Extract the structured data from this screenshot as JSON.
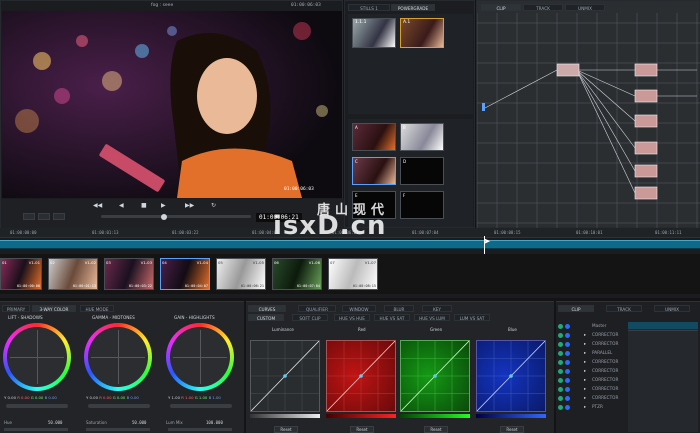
{
  "viewer": {
    "title": "fog : seee",
    "timecode_top": "01:00:06:03",
    "overlay_timecode": "01:00:06:03",
    "bottom_timecode": "01:00:06:21"
  },
  "gallery": {
    "tabs": [
      "STILLS 1",
      "POWERGRADE"
    ],
    "top_stills": [
      {
        "label": "1.1.1"
      },
      {
        "label": "A.1"
      }
    ],
    "memory_labels": [
      "A",
      "B",
      "C",
      "D",
      "E",
      "F"
    ]
  },
  "node_editor": {
    "tabs": [
      "CLIP",
      "TRACK",
      "UNMIX"
    ]
  },
  "timeline": {
    "ruler": [
      "01:00:00:00",
      "01:00:01:13",
      "01:00:03:22",
      "01:00:04:07",
      "01:00:06:21",
      "01:00:07:04",
      "01:00:08:15",
      "01:00:10:01",
      "01:00:11:11"
    ],
    "clips": [
      {
        "id": "01",
        "track": "V1-01",
        "tc": "01:00:00:00"
      },
      {
        "id": "02",
        "track": "V1-02",
        "tc": "01:00:01:13"
      },
      {
        "id": "03",
        "track": "V1-03",
        "tc": "01:00:03:22"
      },
      {
        "id": "04",
        "track": "V1-04",
        "tc": "01:00:04:07"
      },
      {
        "id": "05",
        "track": "V1-05",
        "tc": "01:00:06:21"
      },
      {
        "id": "06",
        "track": "V1-06",
        "tc": "01:00:07:04"
      },
      {
        "id": "07",
        "track": "V1-07",
        "tc": "01:00:08:15"
      }
    ]
  },
  "watermark": {
    "text": "isxD.cn",
    "cn": "唐山现代"
  },
  "color_panel": {
    "tabs": [
      "PRIMARY",
      "3-WAY COLOR",
      "HUE MODE"
    ],
    "wheels": [
      {
        "label": "LIFT - SHADOWS",
        "values": [
          "Y 0.00",
          "R 0.00",
          "G 0.00",
          "B 0.00"
        ]
      },
      {
        "label": "GAMMA - MIDTONES",
        "values": [
          "Y 0.00",
          "R 0.00",
          "G 0.00",
          "B 0.00"
        ]
      },
      {
        "label": "GAIN - HIGHLIGHTS",
        "values": [
          "Y 1.00",
          "R 1.00",
          "G 1.00",
          "B 1.00"
        ]
      }
    ],
    "params": [
      {
        "label": "Hue",
        "value": "50.000"
      },
      {
        "label": "Saturation",
        "value": "50.000"
      },
      {
        "label": "Lum Mix",
        "value": "100.000"
      }
    ]
  },
  "curves": {
    "tabs": [
      "CURVES",
      "QUALIFIER",
      "WINDOW",
      "BLUR",
      "KEY"
    ],
    "subtabs": [
      "CUSTOM",
      "SOFT CLIP",
      "HUE VS HUE",
      "HUE VS SAT",
      "HUE VS LUM",
      "LUM VS SAT"
    ],
    "channels": [
      {
        "label": "Luminance",
        "color": "#d8d8d8",
        "bg": "#2a2d30"
      },
      {
        "label": "Red",
        "color": "#ff3a3a",
        "bg": "#8a0c0c"
      },
      {
        "label": "Green",
        "color": "#3aff3a",
        "bg": "#0c6a0c"
      },
      {
        "label": "Blue",
        "color": "#3a7aff",
        "bg": "#0a1f8a"
      }
    ],
    "reset_label": "Reset"
  },
  "node_list": {
    "tabs": [
      "CLIP",
      "TRACK",
      "UNMIX"
    ],
    "items": [
      "Master",
      "CORRECTOR",
      "CORRECTOR",
      "PARALLEL",
      "CORRECTOR",
      "CORRECTOR",
      "CORRECTOR",
      "CORRECTOR",
      "CORRECTOR",
      "PTZR"
    ]
  }
}
